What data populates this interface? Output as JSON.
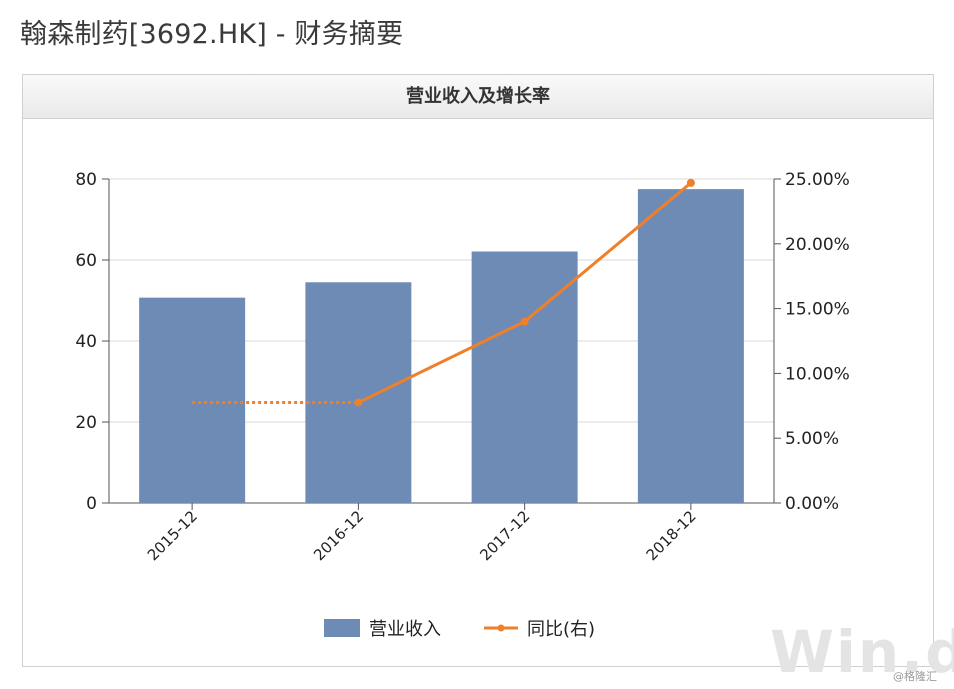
{
  "page_title": "翰森制药[3692.HK] - 财务摘要",
  "panel_title": "营业收入及增长率",
  "watermark": {
    "logo": "Win.d",
    "credit": "@格隆汇"
  },
  "colors": {
    "bar": "#6e8bb5",
    "line": "#f07f2a",
    "axis": "#555555",
    "grid": "#d8d8d8"
  },
  "chart_data": {
    "type": "bar",
    "title": "营业收入及增长率",
    "categories": [
      "2015-12",
      "2016-12",
      "2017-12",
      "2018-12"
    ],
    "series": [
      {
        "name": "营业收入",
        "type": "bar",
        "axis": "left",
        "values": [
          50.7,
          54.5,
          62.1,
          77.5
        ]
      },
      {
        "name": "同比(右)",
        "type": "line",
        "axis": "right",
        "values": [
          7.75,
          7.75,
          14.0,
          24.7
        ],
        "dashed_segments": [
          0
        ]
      }
    ],
    "y_left": {
      "ylim": [
        0,
        80
      ],
      "ticks": [
        "0",
        "20",
        "40",
        "60",
        "80"
      ]
    },
    "y_right": {
      "ylim": [
        0,
        25
      ],
      "ticks": [
        "0.00%",
        "5.00%",
        "10.00%",
        "15.00%",
        "20.00%",
        "25.00%"
      ]
    },
    "grid": true,
    "legend_position": "bottom"
  }
}
